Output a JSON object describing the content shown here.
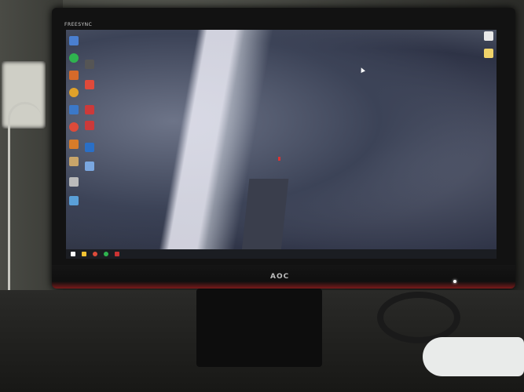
{
  "monitor": {
    "brand_label": "FREESYNC",
    "maker_logo": "AOC",
    "power_led": "white"
  },
  "desktop": {
    "left_icons": [
      "app-icon",
      "app-icon",
      "app-icon",
      "app-icon",
      "app-icon",
      "app-icon",
      "app-icon",
      "app-icon",
      "app-icon",
      "app-icon",
      "app-icon",
      "app-icon"
    ],
    "right_icons": [
      "folder-icon",
      "folder-icon"
    ]
  },
  "taskbar": {
    "items": [
      "start-icon",
      "file-explorer-icon",
      "browser-icon",
      "app-icon",
      "app-icon"
    ]
  }
}
